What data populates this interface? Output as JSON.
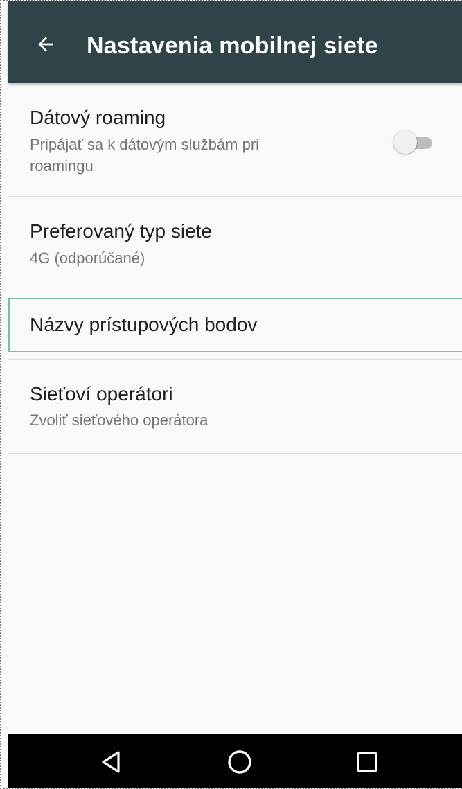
{
  "toolbar": {
    "title": "Nastavenia mobilnej siete",
    "back_icon": "arrow-back-icon"
  },
  "preferences": [
    {
      "title": "Dátový roaming",
      "summary": "Pripájať sa k dátovým službám pri roamingu",
      "toggle_on": false
    },
    {
      "title": "Preferovaný typ siete",
      "summary": "4G (odporúčané)"
    },
    {
      "title": "Názvy prístupových bodov"
    },
    {
      "title": "Sieťoví operátori",
      "summary": "Zvoliť sieťového operátora"
    }
  ],
  "navbar": {
    "back_icon": "nav-back-icon",
    "home_icon": "nav-home-icon",
    "recents_icon": "nav-recents-icon"
  },
  "colors": {
    "toolbar": "#2f4348",
    "focus_border": "#80bab0",
    "background": "#fafafa"
  }
}
